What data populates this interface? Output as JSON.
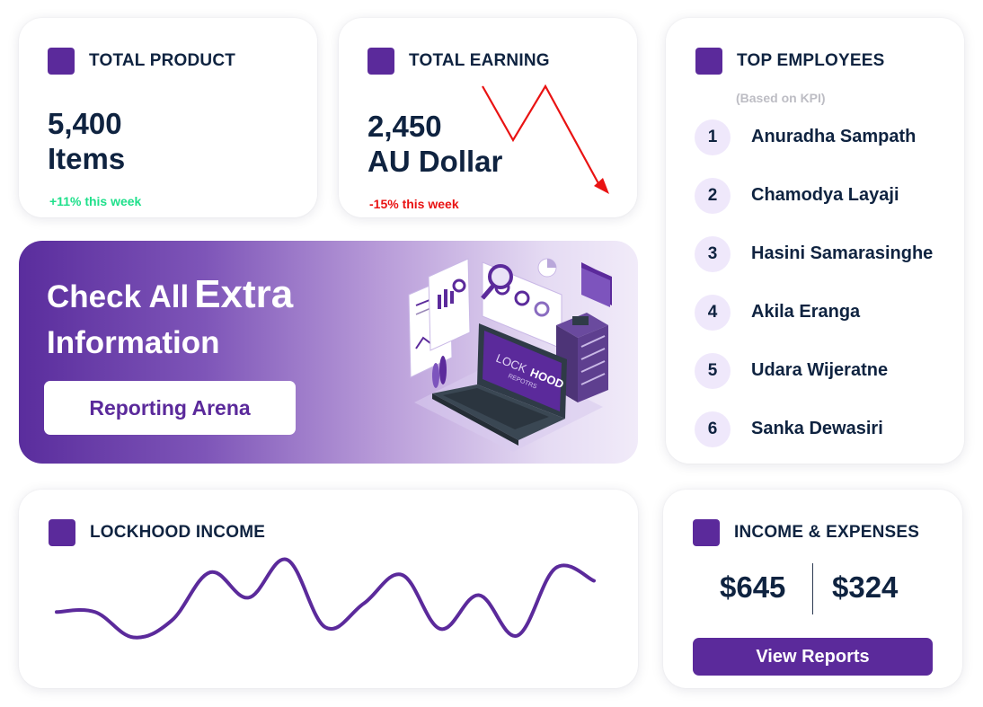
{
  "colors": {
    "brand": "#5b2a9b",
    "text": "#0f2340",
    "positive": "#1fe08b",
    "negative": "#e91313",
    "muted": "#bdbdc4"
  },
  "total_product": {
    "title": "TOTAL PRODUCT",
    "value": "5,400",
    "unit": "Items",
    "delta": "+11% this week"
  },
  "total_earning": {
    "title": "TOTAL EARNING",
    "value": "2,450",
    "unit": "AU Dollar",
    "delta": "-15% this week",
    "trend_icon": "down-trend-arrow-icon"
  },
  "top_employees": {
    "title": "TOP EMPLOYEES",
    "subtitle": "(Based on KPI)",
    "items": [
      {
        "rank": "1",
        "name": "Anuradha Sampath"
      },
      {
        "rank": "2",
        "name": "Chamodya Layaji"
      },
      {
        "rank": "3",
        "name": "Hasini Samarasinghe"
      },
      {
        "rank": "4",
        "name": "Akila Eranga"
      },
      {
        "rank": "5",
        "name": "Udara Wijeratne"
      },
      {
        "rank": "6",
        "name": "Sanka Dewasiri"
      }
    ]
  },
  "banner": {
    "heading_part1": "Check All",
    "heading_part2": "Extra",
    "heading_line2": "Information",
    "button_label": "Reporting Arena",
    "laptop_brand_a": "LOCK",
    "laptop_brand_b": "HOOD",
    "laptop_sub": "REPOTRS"
  },
  "lockhood_income": {
    "title": "LOCKHOOD INCOME"
  },
  "chart_data": {
    "type": "line",
    "title": "LOCKHOOD INCOME",
    "xlabel": "",
    "ylabel": "",
    "grid": false,
    "series": [
      {
        "values": [
          38,
          38,
          8,
          28,
          85,
          55,
          100,
          20,
          48,
          82,
          18,
          58,
          10,
          90,
          75
        ]
      }
    ],
    "ylim": [
      0,
      100
    ]
  },
  "income_expenses": {
    "title": "INCOME & EXPENSES",
    "income": "$645",
    "expenses": "$324",
    "button_label": "View Reports"
  }
}
